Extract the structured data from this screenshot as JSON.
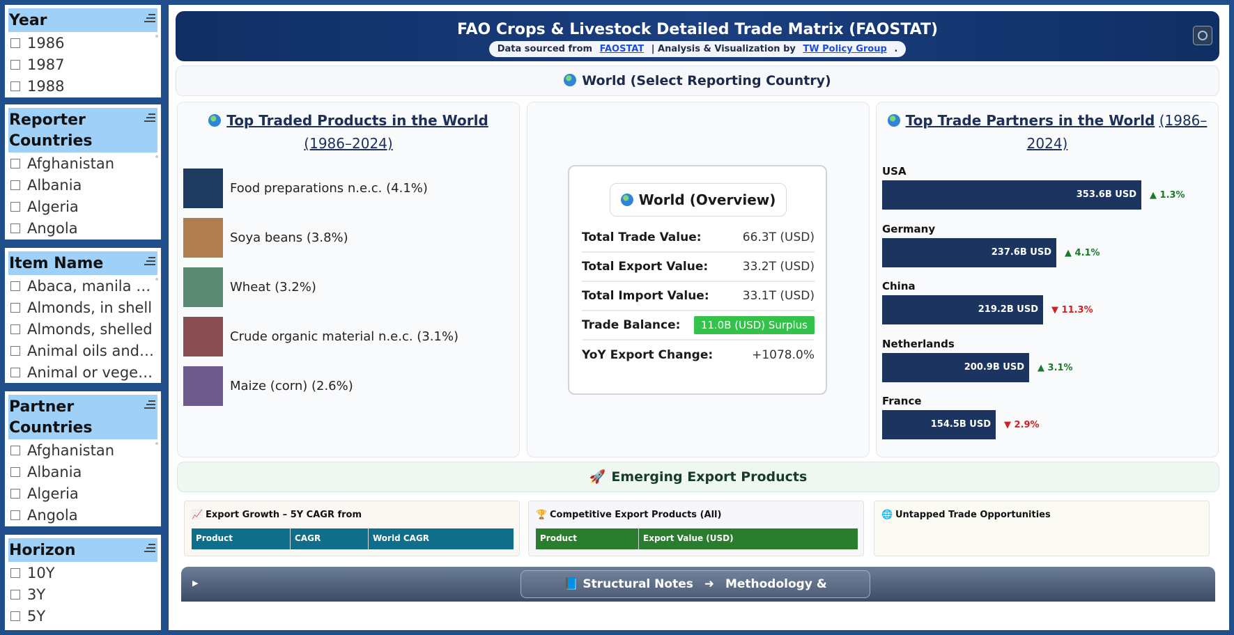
{
  "slicers": {
    "year": {
      "title": "Year",
      "items": [
        "1986",
        "1987",
        "1988"
      ]
    },
    "reporter": {
      "title": "Reporter Countries",
      "items": [
        "Afghanistan",
        "Albania",
        "Algeria",
        "Angola"
      ]
    },
    "item": {
      "title": "Item Name",
      "items": [
        "Abaca, manila h...",
        "Almonds, in shell",
        "Almonds, shelled",
        "Animal oils and ...",
        "Animal or veget..."
      ]
    },
    "partner": {
      "title": "Partner Countries",
      "items": [
        "Afghanistan",
        "Albania",
        "Algeria",
        "Angola"
      ]
    },
    "horizon": {
      "title": "Horizon",
      "items": [
        "10Y",
        "3Y",
        "5Y"
      ]
    }
  },
  "header": {
    "title": "FAO Crops & Livestock Detailed Trade Matrix (FAOSTAT)",
    "sourced_prefix": "Data sourced from",
    "source_link": "FAOSTAT",
    "analysis_prefix": "| Analysis & Visualization by",
    "analysis_link": "TW Policy Group",
    "suffix": "."
  },
  "world_bar": {
    "label": "World (Select Reporting Country)"
  },
  "products": {
    "title_strong": "Top Traded Products in the World",
    "title_years": "(1986–2024)",
    "items": [
      {
        "label": "Food preparations n.e.c. (4.1%)",
        "color": "#1e3a5f"
      },
      {
        "label": "Soya beans (3.8%)",
        "color": "#b07d50"
      },
      {
        "label": "Wheat (3.2%)",
        "color": "#5b8a74"
      },
      {
        "label": "Crude organic material n.e.c. (3.1%)",
        "color": "#8a4e52"
      },
      {
        "label": "Maize (corn) (2.6%)",
        "color": "#6e5a8c"
      }
    ]
  },
  "overview": {
    "title": "World (Overview)",
    "rows": [
      {
        "key": "Total Trade Value:",
        "value": "66.3T (USD)"
      },
      {
        "key": "Total Export Value:",
        "value": "33.2T (USD)"
      },
      {
        "key": "Total Import Value:",
        "value": "33.1T (USD)"
      },
      {
        "key": "Trade Balance:",
        "value": "11.0B (USD) Surplus"
      },
      {
        "key": "YoY Export Change:",
        "value": "+1078.0%"
      }
    ],
    "surplus_color": "#35c24b"
  },
  "partners": {
    "title_strong": "Top Trade Partners in the World",
    "title_years": "(1986–2024)",
    "items": [
      {
        "name": "USA",
        "value_label": "353.6B USD",
        "value": 353.6,
        "delta": "▲ 1.3%",
        "dir": "up"
      },
      {
        "name": "Germany",
        "value_label": "237.6B USD",
        "value": 237.6,
        "delta": "▲ 4.1%",
        "dir": "up"
      },
      {
        "name": "China",
        "value_label": "219.2B USD",
        "value": 219.2,
        "delta": "▼ 11.3%",
        "dir": "down"
      },
      {
        "name": "Netherlands",
        "value_label": "200.9B USD",
        "value": 200.9,
        "delta": "▲ 3.1%",
        "dir": "up"
      },
      {
        "name": "France",
        "value_label": "154.5B USD",
        "value": 154.5,
        "delta": "▼ 2.9%",
        "dir": "down"
      }
    ],
    "bar_color": "#1c3560"
  },
  "emerging": {
    "title": "Emerging Export Products",
    "growth": {
      "title": "Export Growth – 5Y CAGR from",
      "columns": [
        "Product",
        "CAGR",
        "World CAGR"
      ],
      "header_color": "#0f6e8a"
    },
    "competitive": {
      "title": "Competitive Export Products (All)",
      "columns": [
        "Product",
        "Export Value (USD)"
      ],
      "header_color": "#2a7d2e"
    },
    "untapped": {
      "title": "Untapped Trade Opportunities"
    }
  },
  "notes": {
    "left": "Structural Notes",
    "arrow": "➜",
    "right": "Methodology & Transparency"
  }
}
